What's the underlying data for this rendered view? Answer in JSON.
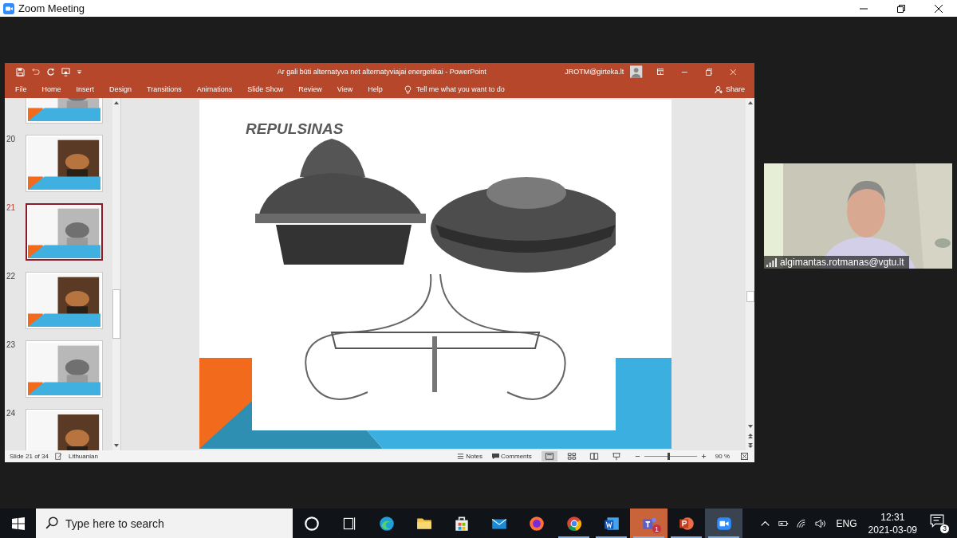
{
  "zoom_window": {
    "title": "Zoom Meeting"
  },
  "powerpoint": {
    "title": "Ar gali būti alternatyva net alternatyviajai energetikai  -  PowerPoint",
    "account": "JROTM@girteka.lt",
    "menu": [
      "File",
      "Home",
      "Insert",
      "Design",
      "Transitions",
      "Animations",
      "Slide Show",
      "Review",
      "View",
      "Help"
    ],
    "tell_me": "Tell me what you want to do",
    "share": "Share",
    "thumbnails": [
      {
        "selected": false
      },
      {
        "number": "20",
        "selected": false
      },
      {
        "number": "21",
        "selected": true
      },
      {
        "number": "22",
        "selected": false
      },
      {
        "number": "23",
        "selected": false
      },
      {
        "number": "24",
        "selected": false
      }
    ],
    "slide": {
      "title": "REPULSINAS"
    },
    "status": {
      "slide": "Slide 21 of 34",
      "language": "Lithuanian",
      "notes": "Notes",
      "comments": "Comments",
      "zoom": "90 %",
      "level": 0.45
    }
  },
  "video": {
    "name": "algimantas.rotmanas@vgtu.lt"
  },
  "taskbar": {
    "search": {
      "placeholder": "Type here to search"
    },
    "apps": [
      {
        "kind": "cortana",
        "running": false,
        "selected": false,
        "flashing": false
      },
      {
        "kind": "taskview",
        "running": false,
        "selected": false,
        "flashing": false
      },
      {
        "kind": "edge",
        "running": false,
        "selected": false,
        "flashing": false
      },
      {
        "kind": "explorer",
        "running": false,
        "selected": false,
        "flashing": false
      },
      {
        "kind": "store",
        "running": false,
        "selected": false,
        "flashing": false
      },
      {
        "kind": "mail",
        "running": false,
        "selected": false,
        "flashing": false
      },
      {
        "kind": "firefox",
        "running": false,
        "selected": false,
        "flashing": false
      },
      {
        "kind": "chrome",
        "running": true,
        "selected": false,
        "flashing": false
      },
      {
        "kind": "word",
        "running": true,
        "selected": false,
        "flashing": false
      },
      {
        "kind": "teams",
        "running": true,
        "selected": false,
        "flashing": true,
        "badge": "1"
      },
      {
        "kind": "powerpoint",
        "running": true,
        "selected": false,
        "flashing": false
      },
      {
        "kind": "zoom",
        "running": true,
        "selected": true,
        "flashing": false
      }
    ],
    "language": "ENG",
    "time": "12:31",
    "date": "2021-03-09",
    "notifications": "3"
  }
}
